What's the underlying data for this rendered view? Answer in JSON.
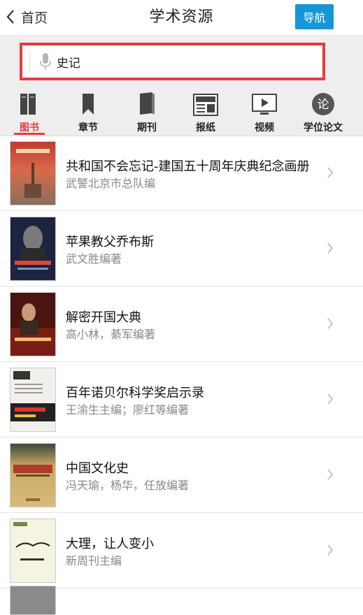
{
  "header": {
    "back_label": "首页",
    "title": "学术资源",
    "nav_label": "导航"
  },
  "search": {
    "query": "史记"
  },
  "categories": [
    {
      "label": "图书",
      "icon": "books-icon",
      "active": true
    },
    {
      "label": "章节",
      "icon": "bookmark-icon",
      "active": false
    },
    {
      "label": "期刊",
      "icon": "journal-icon",
      "active": false
    },
    {
      "label": "报纸",
      "icon": "newspaper-icon",
      "active": false
    },
    {
      "label": "视频",
      "icon": "video-icon",
      "active": false
    },
    {
      "label": "学位论文",
      "icon": "thesis-icon",
      "active": false
    }
  ],
  "books": [
    {
      "title": "共和国不会忘记-建国五十周年庆典纪念画册",
      "author": "武警北京市总队编",
      "cover_color": "#b84a3c"
    },
    {
      "title": "苹果教父乔布斯",
      "author": "武文胜编著",
      "cover_color": "#1c2540"
    },
    {
      "title": "解密开国大典",
      "author": "高小林，綦军编著",
      "cover_color": "#6b1d14"
    },
    {
      "title": "百年诺贝尔科学奖启示录",
      "author": "王渝生主编；廖红等编著",
      "cover_color": "#f2f0ea"
    },
    {
      "title": "中国文化史",
      "author": "冯天瑜，杨华，任放编著",
      "cover_color": "#c9a865"
    },
    {
      "title": "大理，让人变小",
      "author": "新周刊主编",
      "cover_color": "#f7f3e3"
    }
  ],
  "colors": {
    "accent": "#e43d40",
    "nav_button": "#1596d8"
  }
}
